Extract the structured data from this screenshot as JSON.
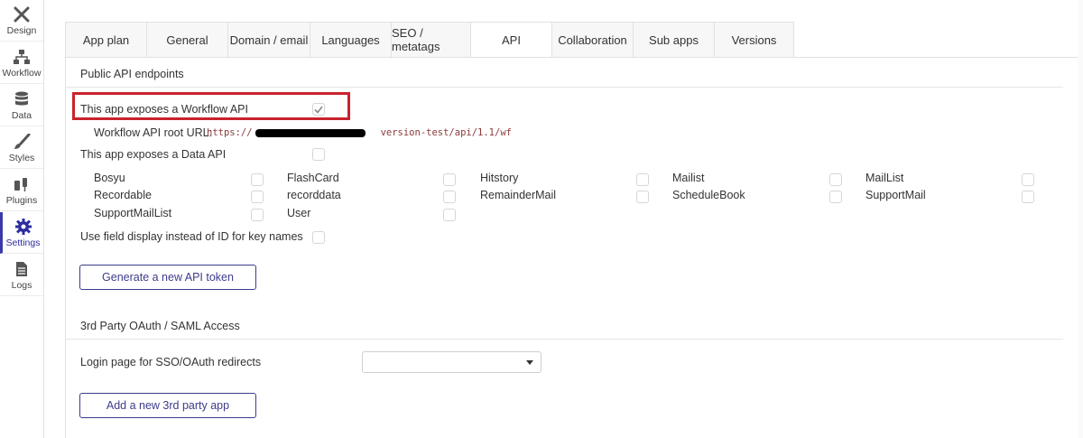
{
  "sidebar": {
    "items": [
      {
        "label": "Design",
        "icon": "design-tools-icon"
      },
      {
        "label": "Workflow",
        "icon": "workflow-icon"
      },
      {
        "label": "Data",
        "icon": "database-icon"
      },
      {
        "label": "Styles",
        "icon": "brush-icon"
      },
      {
        "label": "Plugins",
        "icon": "plug-icon"
      },
      {
        "label": "Settings",
        "icon": "gear-icon",
        "active": true
      },
      {
        "label": "Logs",
        "icon": "document-icon"
      }
    ]
  },
  "tabs": [
    {
      "label": "App plan"
    },
    {
      "label": "General"
    },
    {
      "label": "Domain / email"
    },
    {
      "label": "Languages"
    },
    {
      "label": "SEO / metatags"
    },
    {
      "label": "API",
      "active": true
    },
    {
      "label": "Collaboration"
    },
    {
      "label": "Sub apps"
    },
    {
      "label": "Versions"
    }
  ],
  "api": {
    "public_title": "Public API endpoints",
    "workflow_api_label": "This app exposes a Workflow API",
    "workflow_api_checked": true,
    "workflow_root_label": "Workflow API root URL:",
    "workflow_root_prefix": "https://",
    "workflow_root_suffix": "version-test/api/1.1/wf",
    "data_api_label": "This app exposes a Data API",
    "data_api_checked": false,
    "data_types": [
      "Bosyu",
      "FlashCard",
      "Hitstory",
      "Mailist",
      "MailList",
      "Recordable",
      "recorddata",
      "RemainderMail",
      "ScheduleBook",
      "SupportMail",
      "SupportMailList",
      "User"
    ],
    "field_display_label": "Use field display instead of ID for key names",
    "generate_token_label": "Generate a new API token"
  },
  "oauth": {
    "title": "3rd Party OAuth / SAML Access",
    "login_page_label": "Login page for SSO/OAuth redirects",
    "login_page_value": "",
    "add_app_label": "Add a new 3rd party app"
  },
  "colors": {
    "accent": "#3c3c8c",
    "highlight": "#c8232c",
    "active_nav": "#2c2ca0"
  }
}
